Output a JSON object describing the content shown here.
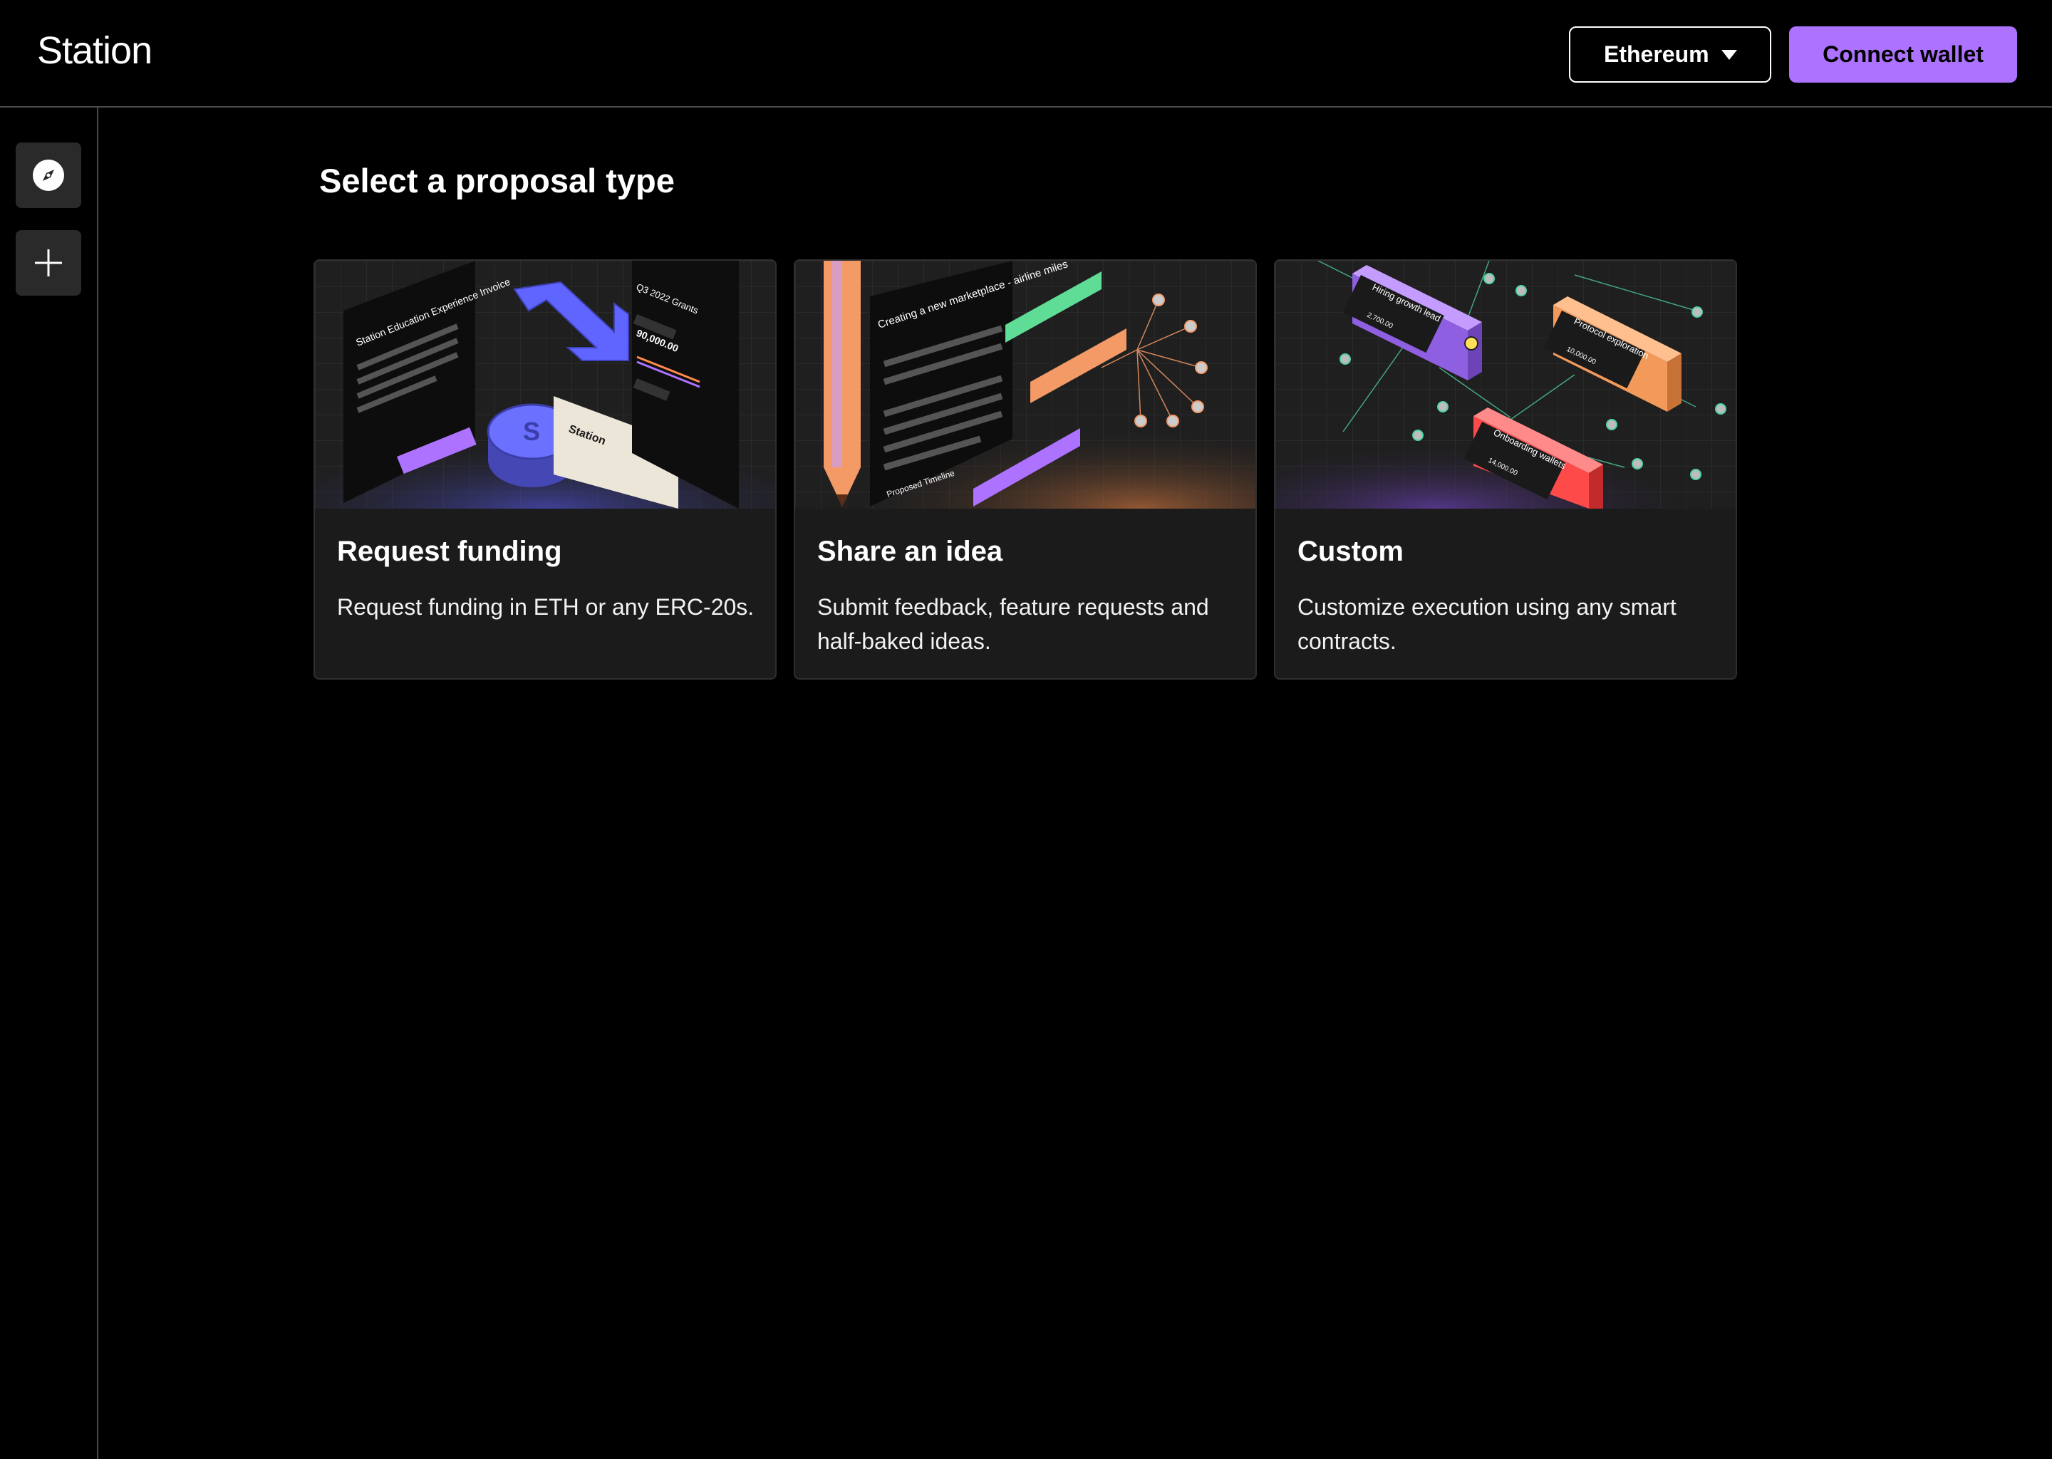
{
  "header": {
    "logo": "Station",
    "network_select": "Ethereum",
    "connect_label": "Connect wallet"
  },
  "main": {
    "title": "Select a proposal type",
    "cards": [
      {
        "title": "Request funding",
        "description": "Request funding in ETH or any ERC-20s.",
        "illustration": {
          "doc_title": "Station Education Experience Invoice",
          "grant": "Q3 2022 Grants",
          "amount": "90,000.00",
          "badge": "Station"
        }
      },
      {
        "title": "Share an idea",
        "description": "Submit feedback, feature requests and half-baked ideas.",
        "illustration": {
          "doc_title": "Creating a new marketplace - airline miles",
          "timeline": "Proposed Timeline"
        }
      },
      {
        "title": "Custom",
        "description": "Customize execution using any smart contracts.",
        "illustration": {
          "block1": "Hiring growth lead",
          "block2": "Protocol exploration",
          "block3": "Onboarding wallets",
          "val1": "2,700.00",
          "val2": "10,000.00",
          "val3": "14,000.00"
        }
      }
    ]
  },
  "colors": {
    "accent": "#ad72ff",
    "background": "#000000",
    "card": "#1b1b1b",
    "border": "#4a4a4a"
  },
  "icons": {
    "explore": "compass-icon",
    "add": "plus-icon",
    "network": "caret-down-icon"
  }
}
